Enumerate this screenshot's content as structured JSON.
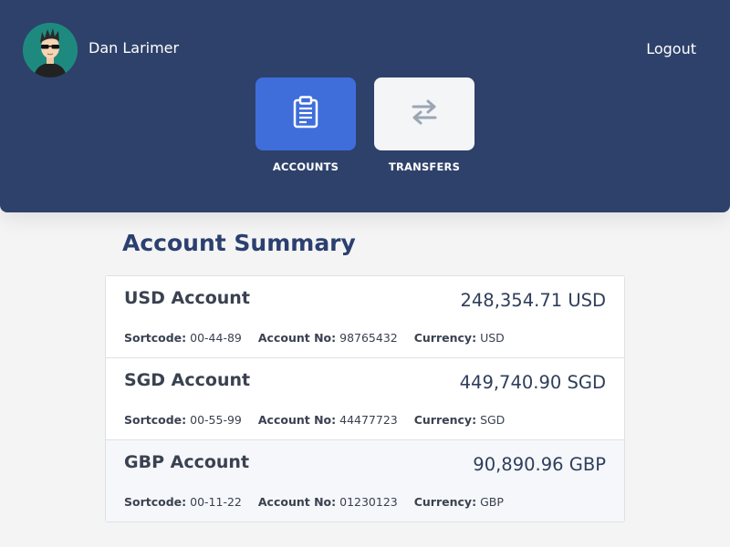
{
  "user": {
    "name": "Dan Larimer",
    "logout_label": "Logout"
  },
  "nav": {
    "items": [
      {
        "label": "ACCOUNTS",
        "icon": "clipboard-icon",
        "active": true
      },
      {
        "label": "TRANSFERS",
        "icon": "transfer-arrows-icon",
        "active": false
      }
    ]
  },
  "main": {
    "title": "Account Summary",
    "field_labels": {
      "sortcode": "Sortcode:",
      "account_no": "Account No:",
      "currency": "Currency:"
    },
    "accounts": [
      {
        "name": "USD Account",
        "balance": "248,354.71 USD",
        "sortcode": "00-44-89",
        "account_no": "98765432",
        "currency": "USD"
      },
      {
        "name": "SGD Account",
        "balance": "449,740.90 SGD",
        "sortcode": "00-55-99",
        "account_no": "44477723",
        "currency": "SGD"
      },
      {
        "name": "GBP Account",
        "balance": "90,890.96 GBP",
        "sortcode": "00-11-22",
        "account_no": "01230123",
        "currency": "GBP"
      }
    ]
  },
  "colors": {
    "header_bg": "#2e416a",
    "active_button": "#3f6edb",
    "inactive_button": "#f4f5f7",
    "title_text": "#2b4070",
    "page_bg": "#f4f4f4"
  }
}
